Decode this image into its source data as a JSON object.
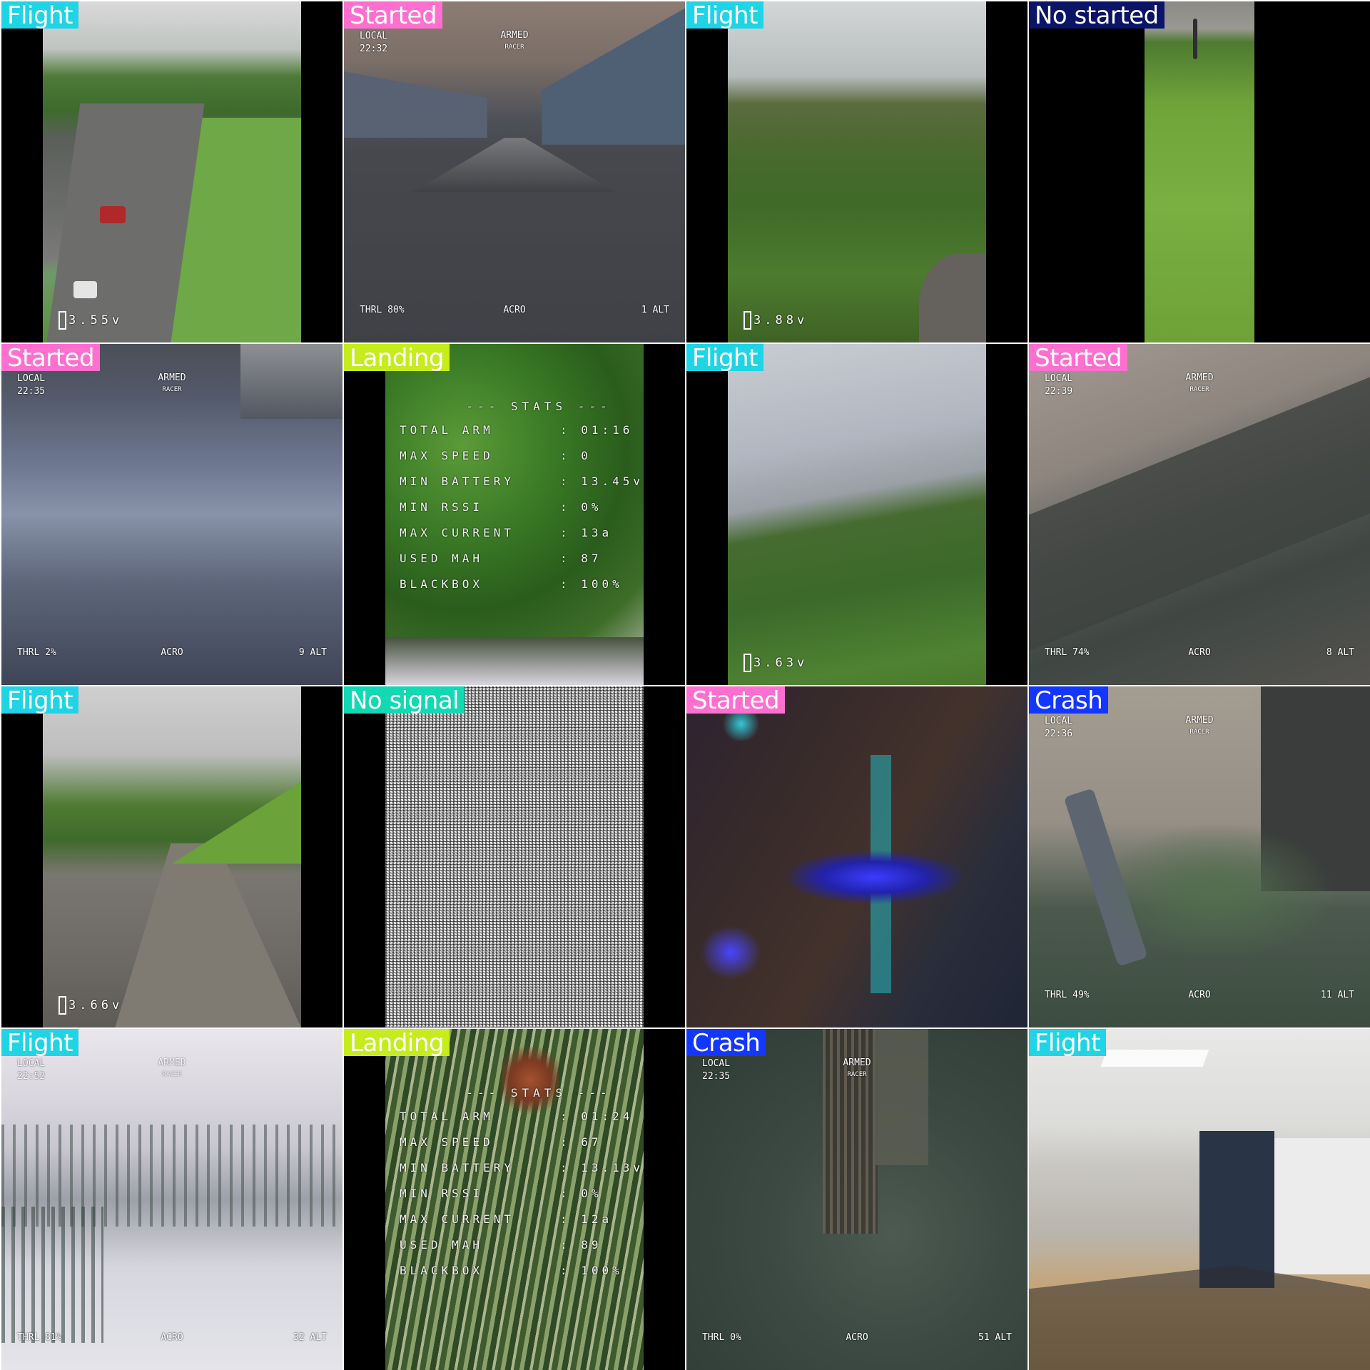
{
  "label_colors": {
    "Flight": "#20d4e6",
    "Started": "#ff6fd0",
    "No started": "#0b1466",
    "Landing": "#c6ec1e",
    "No signal": "#11d9b3",
    "Crash": "#1437ff"
  },
  "tiles": [
    {
      "label": "Flight",
      "scene": "parking-lot-aerial",
      "osd": {
        "battery": "3.55v"
      }
    },
    {
      "label": "Started",
      "scene": "sim-street",
      "osd": {
        "local": "LOCAL",
        "time": "22:32",
        "armed": "ARMED",
        "racer": "RACER",
        "thrl": "THRL 80%",
        "mode": "ACRO",
        "alt": "1 ALT"
      }
    },
    {
      "label": "Flight",
      "scene": "trees-cloudy",
      "osd": {
        "battery": "3.88v"
      }
    },
    {
      "label": "No started",
      "scene": "phone-grass-field",
      "osd": {}
    },
    {
      "label": "Started",
      "scene": "sim-blur-floor",
      "osd": {
        "local": "LOCAL",
        "time": "22:35",
        "armed": "ARMED",
        "racer": "RACER",
        "thrl": "THRL 2%",
        "mode": "ACRO",
        "alt": "9 ALT"
      }
    },
    {
      "label": "Landing",
      "scene": "stats-green-leaves",
      "stats": {
        "title": "--- STATS ---",
        "rows": [
          {
            "k": "TOTAL ARM",
            "v": ": 01:16"
          },
          {
            "k": "MAX SPEED",
            "v": ": 0"
          },
          {
            "k": "MIN BATTERY",
            "v": ": 13.45v"
          },
          {
            "k": "MIN RSSI",
            "v": ": 0%"
          },
          {
            "k": "MAX CURRENT",
            "v": ": 13a"
          },
          {
            "k": "USED MAH",
            "v": ": 87"
          },
          {
            "k": "BLACKBOX",
            "v": ": 100%"
          }
        ]
      }
    },
    {
      "label": "Flight",
      "scene": "hillside-cloudy",
      "osd": {
        "battery": "3.63v"
      }
    },
    {
      "label": "Started",
      "scene": "sim-crash-wall",
      "osd": {
        "local": "LOCAL",
        "time": "22:39",
        "armed": "ARMED",
        "racer": "RACER",
        "thrl": "THRL 74%",
        "mode": "ACRO",
        "alt": "8 ALT"
      }
    },
    {
      "label": "Flight",
      "scene": "road-parking",
      "osd": {
        "battery": "3.66v"
      }
    },
    {
      "label": "No signal",
      "scene": "static-noise",
      "osd": {}
    },
    {
      "label": "Started",
      "scene": "drone-blue-lights",
      "osd": {}
    },
    {
      "label": "Crash",
      "scene": "sim-tree-pipe",
      "osd": {
        "local": "LOCAL",
        "time": "22:36",
        "armed": "ARMED",
        "racer": "RACER",
        "thrl": "THRL 49%",
        "mode": "ACRO",
        "alt": "11 ALT"
      }
    },
    {
      "label": "Flight",
      "scene": "snow-mountain",
      "osd": {
        "local": "LOCAL",
        "time": "22:52",
        "armed": "ARMED",
        "racer": "RACER",
        "thrl": "THRL 81%",
        "mode": "ACRO",
        "alt": "32 ALT"
      }
    },
    {
      "label": "Landing",
      "scene": "stats-grass-closeup",
      "stats": {
        "title": "--- STATS ---",
        "rows": [
          {
            "k": "TOTAL ARM",
            "v": ": 01:24"
          },
          {
            "k": "MAX SPEED",
            "v": ": 67"
          },
          {
            "k": "MIN BATTERY",
            "v": ": 13.13v"
          },
          {
            "k": "MIN RSSI",
            "v": ": 0%"
          },
          {
            "k": "MAX CURRENT",
            "v": ": 12a"
          },
          {
            "k": "USED MAH",
            "v": ": 89"
          },
          {
            "k": "BLACKBOX",
            "v": ": 100%"
          }
        ]
      }
    },
    {
      "label": "Crash",
      "scene": "sim-topdown-trees",
      "osd": {
        "local": "LOCAL",
        "time": "22:35",
        "armed": "ARMED",
        "racer": "RACER",
        "thrl": "THRL 0%",
        "mode": "ACRO",
        "alt": "51 ALT"
      }
    },
    {
      "label": "Flight",
      "scene": "office-lab",
      "osd": {}
    }
  ]
}
